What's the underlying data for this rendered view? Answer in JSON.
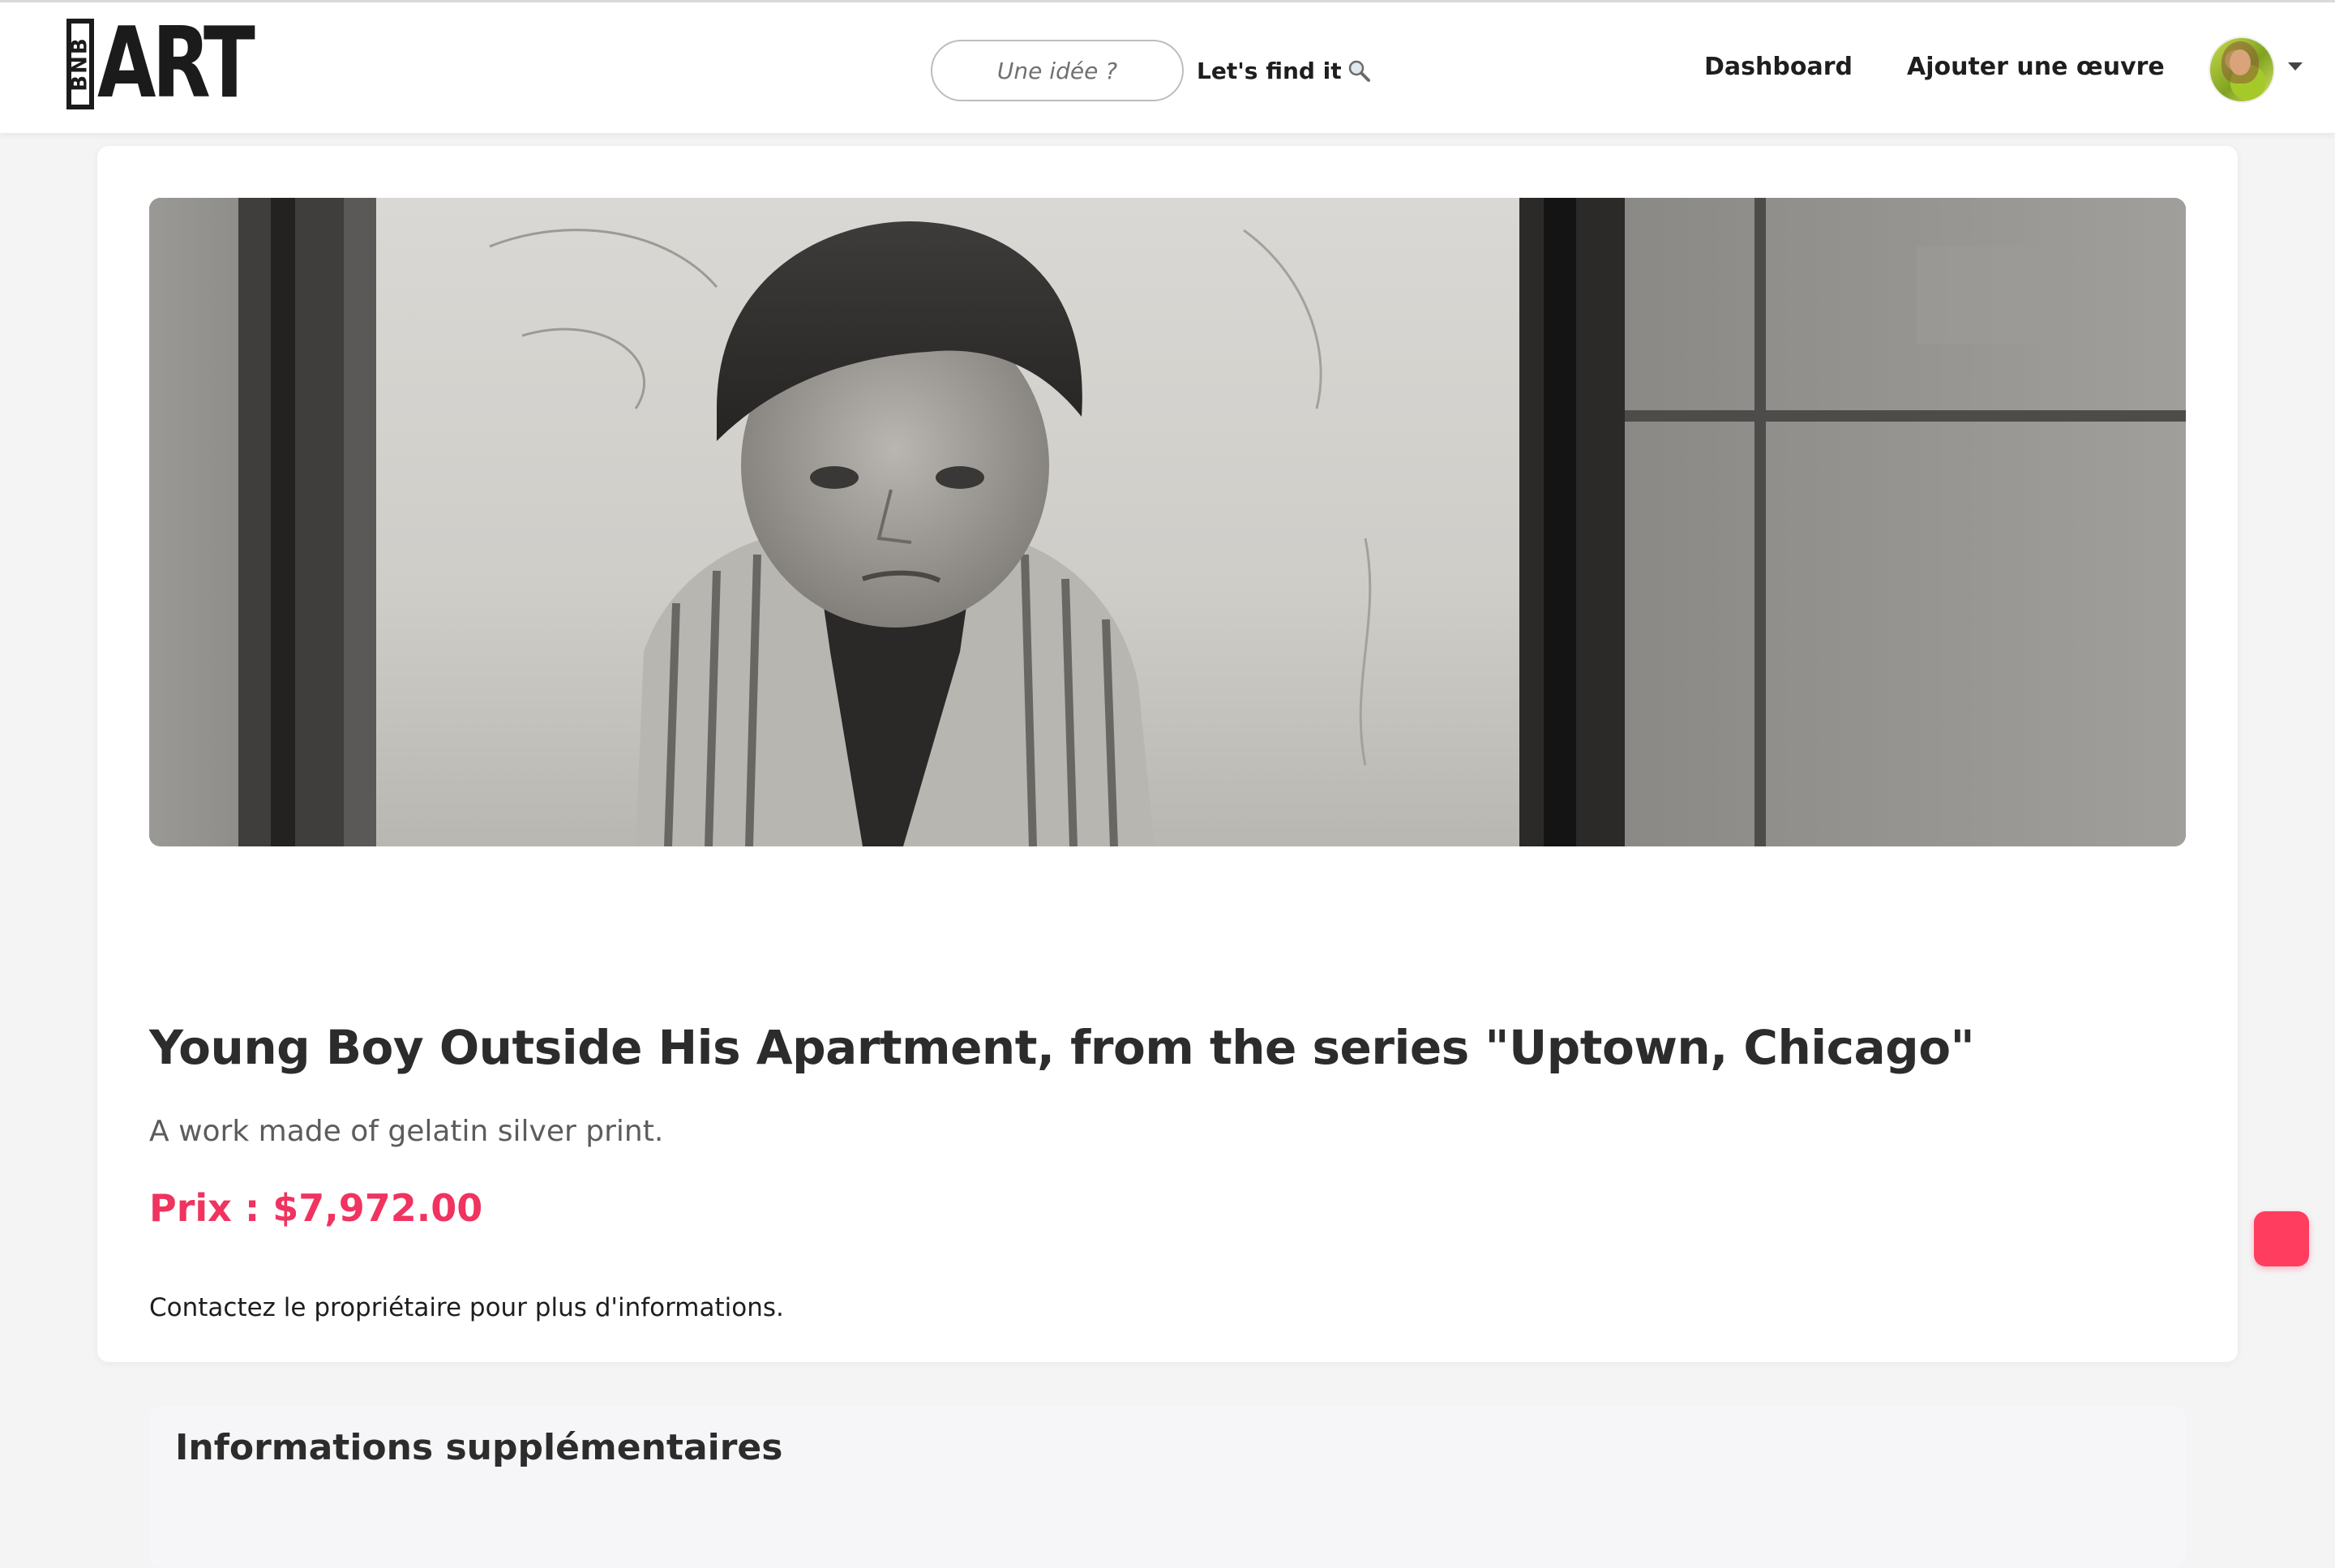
{
  "brand": {
    "logo_box_text": "BNB",
    "logo_word": "ART"
  },
  "header": {
    "search_placeholder": "Une idée ?",
    "find_label": "Let's find it",
    "nav": {
      "dashboard": "Dashboard",
      "add_artwork": "Ajouter une œuvre"
    },
    "avatar_icon": "user-avatar",
    "menu_icon": "caret-down-icon"
  },
  "artwork": {
    "title": "Young Boy Outside His Apartment, from the series \"Uptown, Chicago\"",
    "description": "A work made of gelatin silver print.",
    "price": "Prix : $7,972.00",
    "contact": "Contactez le propriétaire pour plus d'informations."
  },
  "more_info": {
    "title": "Informations supplémentaires"
  },
  "colors": {
    "accent": "#f0335f",
    "floating_button": "#ff3d5f",
    "text": "#262626",
    "muted_text": "#5c5c5c",
    "page_background": "#f4f4f5"
  }
}
